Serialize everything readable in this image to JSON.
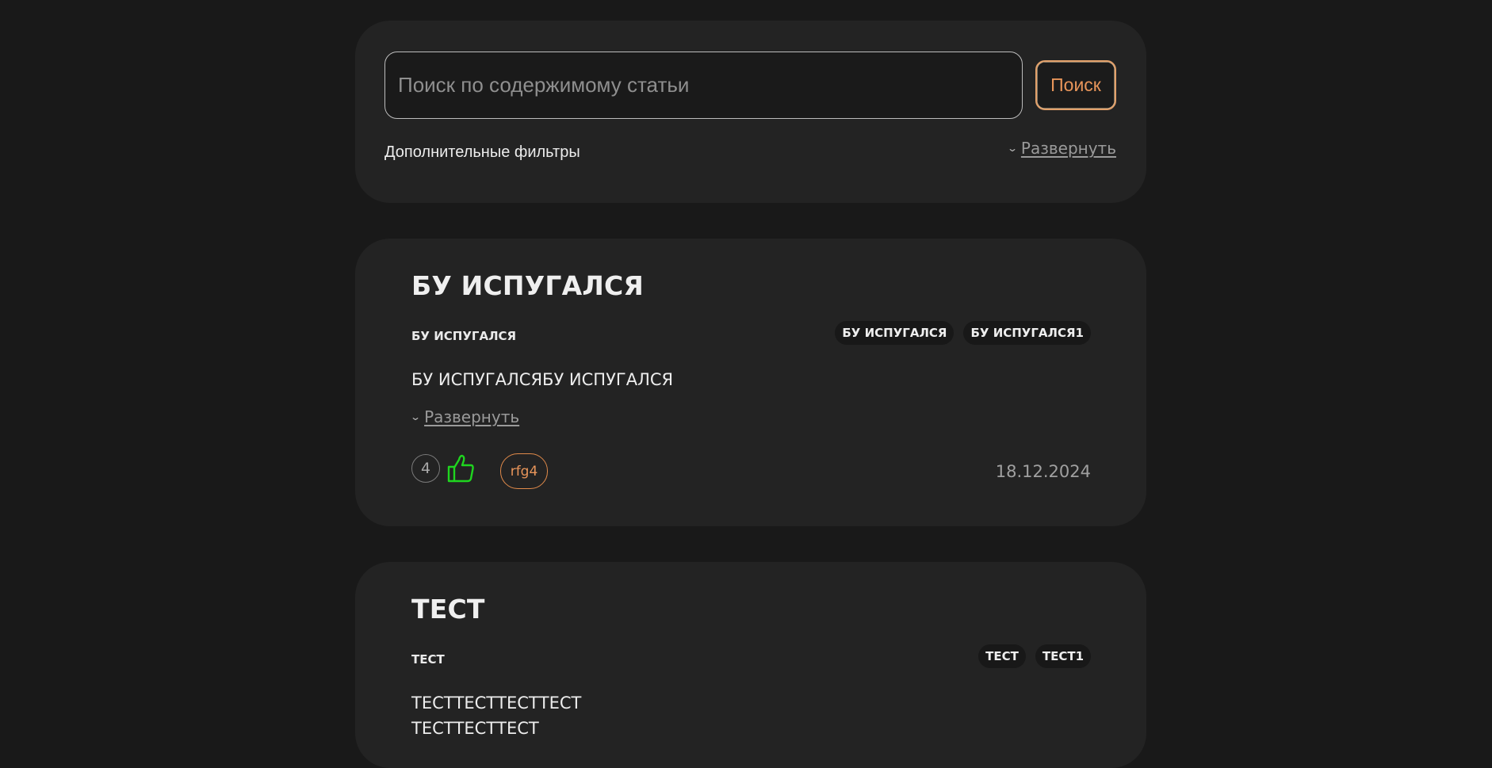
{
  "search": {
    "placeholder": "Поиск по содержимому статьи",
    "button_label": "Поиск",
    "filters_label": "Дополнительные фильтры",
    "expand_label": "Развернуть"
  },
  "articles": [
    {
      "title": "БУ ИСПУГАЛСЯ",
      "subtitle": "БУ ИСПУГАЛСЯ",
      "tags": [
        "БУ ИСПУГАЛСЯ",
        "БУ ИСПУГАЛСЯ1"
      ],
      "body": "БУ ИСПУГАЛСЯБУ ИСПУГАЛСЯ",
      "expand_label": "Развернуть",
      "likes": "4",
      "author": "rfg4",
      "date": "18.12.2024"
    },
    {
      "title": "ТЕСТ",
      "subtitle": "ТЕСТ",
      "tags": [
        "ТЕСТ",
        "ТЕСТ1"
      ],
      "body_lines": [
        "ТЕСТТЕСТТЕСТТЕСТ",
        "ТЕСТТЕСТТЕСТ"
      ]
    }
  ],
  "colors": {
    "background": "#191919",
    "card": "#232323",
    "accent_orange": "#e8955a",
    "like_green": "#1fd51f"
  },
  "icons": {
    "chevron": "chevron-down-icon",
    "like": "thumbs-up-icon"
  }
}
